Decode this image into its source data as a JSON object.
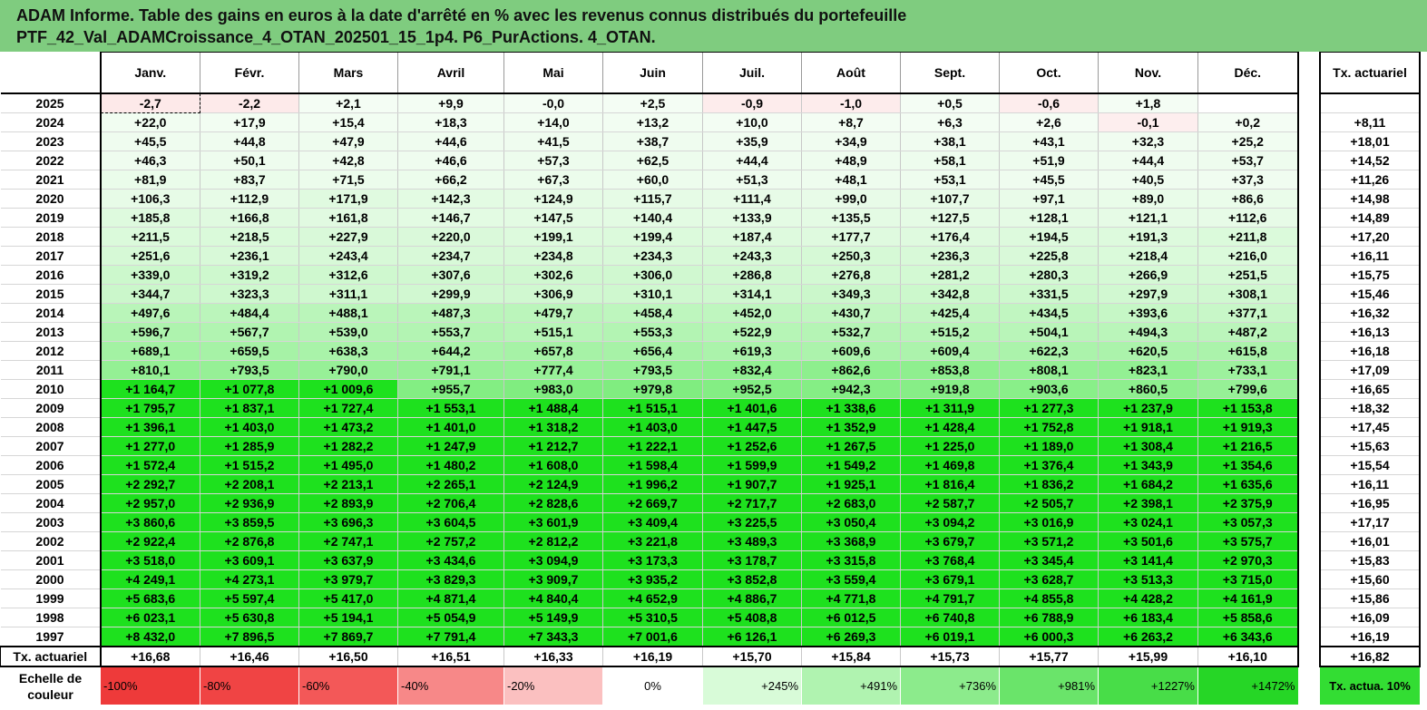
{
  "title": {
    "line1": "ADAM Informe. Table des gains en euros à la date d'arrêté en % avec les revenus connus distribués du portefeuille",
    "line2": "PTF_42_Val_ADAMCroissance_4_OTAN_202501_15_1p4. P6_PurActions. 4_OTAN."
  },
  "colors": {
    "title_bg": "#7fcc7f",
    "neg_light": "#fdeeee",
    "pos_light": "#f2fdf2",
    "pos_mid": "#a6f0a6",
    "pos_strong": "#1ee11e"
  },
  "chart_data": {
    "type": "table",
    "months": [
      "Janv.",
      "Févr.",
      "Mars",
      "Avril",
      "Mai",
      "Juin",
      "Juil.",
      "Août",
      "Sept.",
      "Oct.",
      "Nov.",
      "Déc."
    ],
    "side_header": "Tx. actuariel",
    "rows": [
      {
        "year": "2025",
        "cells": [
          "-2,7",
          "-2,2",
          "+2,1",
          "+9,9",
          "-0,0",
          "+2,5",
          "-0,9",
          "-1,0",
          "+0,5",
          "-0,6",
          "+1,8",
          ""
        ],
        "tx": ""
      },
      {
        "year": "2024",
        "cells": [
          "+22,0",
          "+17,9",
          "+15,4",
          "+18,3",
          "+14,0",
          "+13,2",
          "+10,0",
          "+8,7",
          "+6,3",
          "+2,6",
          "-0,1",
          "+0,2"
        ],
        "tx": "+8,11"
      },
      {
        "year": "2023",
        "cells": [
          "+45,5",
          "+44,8",
          "+47,9",
          "+44,6",
          "+41,5",
          "+38,7",
          "+35,9",
          "+34,9",
          "+38,1",
          "+43,1",
          "+32,3",
          "+25,2"
        ],
        "tx": "+18,01"
      },
      {
        "year": "2022",
        "cells": [
          "+46,3",
          "+50,1",
          "+42,8",
          "+46,6",
          "+57,3",
          "+62,5",
          "+44,4",
          "+48,9",
          "+58,1",
          "+51,9",
          "+44,4",
          "+53,7"
        ],
        "tx": "+14,52"
      },
      {
        "year": "2021",
        "cells": [
          "+81,9",
          "+83,7",
          "+71,5",
          "+66,2",
          "+67,3",
          "+60,0",
          "+51,3",
          "+48,1",
          "+53,1",
          "+45,5",
          "+40,5",
          "+37,3"
        ],
        "tx": "+11,26"
      },
      {
        "year": "2020",
        "cells": [
          "+106,3",
          "+112,9",
          "+171,9",
          "+142,3",
          "+124,9",
          "+115,7",
          "+111,4",
          "+99,0",
          "+107,7",
          "+97,1",
          "+89,0",
          "+86,6"
        ],
        "tx": "+14,98"
      },
      {
        "year": "2019",
        "cells": [
          "+185,8",
          "+166,8",
          "+161,8",
          "+146,7",
          "+147,5",
          "+140,4",
          "+133,9",
          "+135,5",
          "+127,5",
          "+128,1",
          "+121,1",
          "+112,6"
        ],
        "tx": "+14,89"
      },
      {
        "year": "2018",
        "cells": [
          "+211,5",
          "+218,5",
          "+227,9",
          "+220,0",
          "+199,1",
          "+199,4",
          "+187,4",
          "+177,7",
          "+176,4",
          "+194,5",
          "+191,3",
          "+211,8"
        ],
        "tx": "+17,20"
      },
      {
        "year": "2017",
        "cells": [
          "+251,6",
          "+236,1",
          "+243,4",
          "+234,7",
          "+234,8",
          "+234,3",
          "+243,3",
          "+250,3",
          "+236,3",
          "+225,8",
          "+218,4",
          "+216,0"
        ],
        "tx": "+16,11"
      },
      {
        "year": "2016",
        "cells": [
          "+339,0",
          "+319,2",
          "+312,6",
          "+307,6",
          "+302,6",
          "+306,0",
          "+286,8",
          "+276,8",
          "+281,2",
          "+280,3",
          "+266,9",
          "+251,5"
        ],
        "tx": "+15,75"
      },
      {
        "year": "2015",
        "cells": [
          "+344,7",
          "+323,3",
          "+311,1",
          "+299,9",
          "+306,9",
          "+310,1",
          "+314,1",
          "+349,3",
          "+342,8",
          "+331,5",
          "+297,9",
          "+308,1"
        ],
        "tx": "+15,46"
      },
      {
        "year": "2014",
        "cells": [
          "+497,6",
          "+484,4",
          "+488,1",
          "+487,3",
          "+479,7",
          "+458,4",
          "+452,0",
          "+430,7",
          "+425,4",
          "+434,5",
          "+393,6",
          "+377,1"
        ],
        "tx": "+16,32"
      },
      {
        "year": "2013",
        "cells": [
          "+596,7",
          "+567,7",
          "+539,0",
          "+553,7",
          "+515,1",
          "+553,3",
          "+522,9",
          "+532,7",
          "+515,2",
          "+504,1",
          "+494,3",
          "+487,2"
        ],
        "tx": "+16,13"
      },
      {
        "year": "2012",
        "cells": [
          "+689,1",
          "+659,5",
          "+638,3",
          "+644,2",
          "+657,8",
          "+656,4",
          "+619,3",
          "+609,6",
          "+609,4",
          "+622,3",
          "+620,5",
          "+615,8"
        ],
        "tx": "+16,18"
      },
      {
        "year": "2011",
        "cells": [
          "+810,1",
          "+793,5",
          "+790,0",
          "+791,1",
          "+777,4",
          "+793,5",
          "+832,4",
          "+862,6",
          "+853,8",
          "+808,1",
          "+823,1",
          "+733,1"
        ],
        "tx": "+17,09"
      },
      {
        "year": "2010",
        "cells": [
          "+1 164,7",
          "+1 077,8",
          "+1 009,6",
          "+955,7",
          "+983,0",
          "+979,8",
          "+952,5",
          "+942,3",
          "+919,8",
          "+903,6",
          "+860,5",
          "+799,6"
        ],
        "tx": "+16,65"
      },
      {
        "year": "2009",
        "cells": [
          "+1 795,7",
          "+1 837,1",
          "+1 727,4",
          "+1 553,1",
          "+1 488,4",
          "+1 515,1",
          "+1 401,6",
          "+1 338,6",
          "+1 311,9",
          "+1 277,3",
          "+1 237,9",
          "+1 153,8"
        ],
        "tx": "+18,32"
      },
      {
        "year": "2008",
        "cells": [
          "+1 396,1",
          "+1 403,0",
          "+1 473,2",
          "+1 401,0",
          "+1 318,2",
          "+1 403,0",
          "+1 447,5",
          "+1 352,9",
          "+1 428,4",
          "+1 752,8",
          "+1 918,1",
          "+1 919,3"
        ],
        "tx": "+17,45"
      },
      {
        "year": "2007",
        "cells": [
          "+1 277,0",
          "+1 285,9",
          "+1 282,2",
          "+1 247,9",
          "+1 212,7",
          "+1 222,1",
          "+1 252,6",
          "+1 267,5",
          "+1 225,0",
          "+1 189,0",
          "+1 308,4",
          "+1 216,5"
        ],
        "tx": "+15,63"
      },
      {
        "year": "2006",
        "cells": [
          "+1 572,4",
          "+1 515,2",
          "+1 495,0",
          "+1 480,2",
          "+1 608,0",
          "+1 598,4",
          "+1 599,9",
          "+1 549,2",
          "+1 469,8",
          "+1 376,4",
          "+1 343,9",
          "+1 354,6"
        ],
        "tx": "+15,54"
      },
      {
        "year": "2005",
        "cells": [
          "+2 292,7",
          "+2 208,1",
          "+2 213,1",
          "+2 265,1",
          "+2 124,9",
          "+1 996,2",
          "+1 907,7",
          "+1 925,1",
          "+1 816,4",
          "+1 836,2",
          "+1 684,2",
          "+1 635,6"
        ],
        "tx": "+16,11"
      },
      {
        "year": "2004",
        "cells": [
          "+2 957,0",
          "+2 936,9",
          "+2 893,9",
          "+2 706,4",
          "+2 828,6",
          "+2 669,7",
          "+2 717,7",
          "+2 683,0",
          "+2 587,7",
          "+2 505,7",
          "+2 398,1",
          "+2 375,9"
        ],
        "tx": "+16,95"
      },
      {
        "year": "2003",
        "cells": [
          "+3 860,6",
          "+3 859,5",
          "+3 696,3",
          "+3 604,5",
          "+3 601,9",
          "+3 409,4",
          "+3 225,5",
          "+3 050,4",
          "+3 094,2",
          "+3 016,9",
          "+3 024,1",
          "+3 057,3"
        ],
        "tx": "+17,17"
      },
      {
        "year": "2002",
        "cells": [
          "+2 922,4",
          "+2 876,8",
          "+2 747,1",
          "+2 757,2",
          "+2 812,2",
          "+3 221,8",
          "+3 489,3",
          "+3 368,9",
          "+3 679,7",
          "+3 571,2",
          "+3 501,6",
          "+3 575,7"
        ],
        "tx": "+16,01"
      },
      {
        "year": "2001",
        "cells": [
          "+3 518,0",
          "+3 609,1",
          "+3 637,9",
          "+3 434,6",
          "+3 094,9",
          "+3 173,3",
          "+3 178,7",
          "+3 315,8",
          "+3 768,4",
          "+3 345,4",
          "+3 141,4",
          "+2 970,3"
        ],
        "tx": "+15,83"
      },
      {
        "year": "2000",
        "cells": [
          "+4 249,1",
          "+4 273,1",
          "+3 979,7",
          "+3 829,3",
          "+3 909,7",
          "+3 935,2",
          "+3 852,8",
          "+3 559,4",
          "+3 679,1",
          "+3 628,7",
          "+3 513,3",
          "+3 715,0"
        ],
        "tx": "+15,60"
      },
      {
        "year": "1999",
        "cells": [
          "+5 683,6",
          "+5 597,4",
          "+5 417,0",
          "+4 871,4",
          "+4 840,4",
          "+4 652,9",
          "+4 886,7",
          "+4 771,8",
          "+4 791,7",
          "+4 855,8",
          "+4 428,2",
          "+4 161,9"
        ],
        "tx": "+15,86"
      },
      {
        "year": "1998",
        "cells": [
          "+6 023,1",
          "+5 630,8",
          "+5 194,1",
          "+5 054,9",
          "+5 149,9",
          "+5 310,5",
          "+5 408,8",
          "+6 012,5",
          "+6 740,8",
          "+6 788,9",
          "+6 183,4",
          "+5 858,6"
        ],
        "tx": "+16,09"
      },
      {
        "year": "1997",
        "cells": [
          "+8 432,0",
          "+7 896,5",
          "+7 869,7",
          "+7 791,4",
          "+7 343,3",
          "+7 001,6",
          "+6 126,1",
          "+6 269,3",
          "+6 019,1",
          "+6 000,3",
          "+6 263,2",
          "+6 343,6"
        ],
        "tx": "+16,19"
      }
    ],
    "footer": {
      "label": "Tx. actuariel",
      "cells": [
        "+16,68",
        "+16,46",
        "+16,50",
        "+16,51",
        "+16,33",
        "+16,19",
        "+15,70",
        "+15,84",
        "+15,73",
        "+15,77",
        "+15,99",
        "+16,10"
      ],
      "tx": "+16,82"
    },
    "scale": {
      "label": "Echelle de couleur",
      "cells": [
        {
          "text": "-100%",
          "color": "#ee3a3a"
        },
        {
          "text": "-80%",
          "color": "#f04444"
        },
        {
          "text": "-60%",
          "color": "#f35858"
        },
        {
          "text": "-40%",
          "color": "#f78888"
        },
        {
          "text": "-20%",
          "color": "#fbc0c0"
        },
        {
          "text": "0%",
          "color": "#ffffff"
        },
        {
          "text": "+245%",
          "color": "#d8fbd8"
        },
        {
          "text": "+491%",
          "color": "#b0f3b0"
        },
        {
          "text": "+736%",
          "color": "#8ceb8c"
        },
        {
          "text": "+981%",
          "color": "#6ae46a"
        },
        {
          "text": "+1227%",
          "color": "#48dd48"
        },
        {
          "text": "+1472%",
          "color": "#26d626"
        }
      ],
      "side": "Tx. actua. 10%"
    }
  }
}
